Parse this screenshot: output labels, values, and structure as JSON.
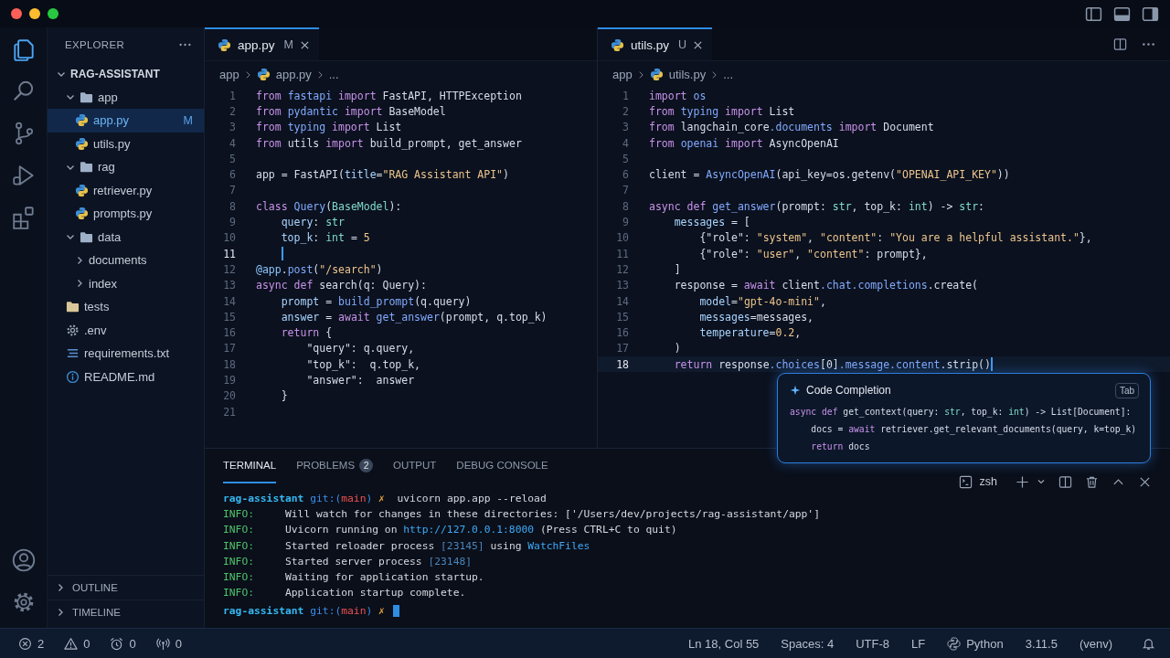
{
  "activity_bar": [
    {
      "kind": "explorer",
      "selected": true
    },
    {
      "kind": "search",
      "selected": false
    },
    {
      "kind": "source-control",
      "selected": false
    },
    {
      "kind": "run",
      "selected": false
    },
    {
      "kind": "extensions",
      "selected": false
    }
  ],
  "activity_bar_bottom": [
    {
      "kind": "account"
    },
    {
      "kind": "settings"
    }
  ],
  "sidebar": {
    "title": "EXPLORER",
    "tree": [
      {
        "label": "RAG-ASSISTANT",
        "kind": "root",
        "expanded": true,
        "children": [
          {
            "label": "app",
            "kind": "folder",
            "expanded": true,
            "children": [
              {
                "label": "app.py",
                "kind": "python",
                "badge": "M",
                "selected": true
              },
              {
                "label": "utils.py",
                "kind": "python",
                "selected": false
              }
            ]
          },
          {
            "label": "rag",
            "kind": "folder",
            "expanded": true,
            "children": [
              {
                "label": "retriever.py",
                "kind": "python",
                "selected": false
              },
              {
                "label": "prompts.py",
                "kind": "python",
                "selected": false
              }
            ]
          },
          {
            "label": "data",
            "kind": "folder",
            "expanded": true,
            "children": [
              {
                "label": "documents",
                "kind": "dir",
                "expanded": false
              },
              {
                "label": "index",
                "kind": "dir",
                "expanded": false
              }
            ]
          },
          {
            "label": "tests",
            "kind": "folder",
            "selected": false
          },
          {
            "label": ".env",
            "kind": "config",
            "selected": false
          },
          {
            "label": "requirements.txt",
            "kind": "text",
            "selected": false
          },
          {
            "label": "README.md",
            "kind": "info",
            "selected": false
          }
        ]
      }
    ],
    "sections": [
      {
        "label": "OUTLINE",
        "expanded": false
      },
      {
        "label": "TIMELINE",
        "expanded": false
      }
    ]
  },
  "editor_groups": [
    {
      "tabs": [
        {
          "label": "app.py",
          "status": "M",
          "selected": true
        }
      ],
      "breadcrumbs": [
        "app",
        "app.py",
        "..."
      ],
      "lines": [
        {
          "n": "1",
          "tokens": [
            {
              "kind": "kw",
              "text": "from"
            },
            {
              "kind": "mod",
              "text": " fastapi"
            },
            {
              "kind": "kw",
              "text": " import"
            },
            {
              "kind": "p",
              "text": " FastAPI, HTTPException"
            }
          ]
        },
        {
          "n": "2",
          "tokens": [
            {
              "kind": "kw",
              "text": "from"
            },
            {
              "kind": "mod",
              "text": " pydantic"
            },
            {
              "kind": "kw",
              "text": " import"
            },
            {
              "kind": "p",
              "text": " BaseModel"
            }
          ]
        },
        {
          "n": "3",
          "tokens": [
            {
              "kind": "kw",
              "text": "from"
            },
            {
              "kind": "mod",
              "text": " typing"
            },
            {
              "kind": "kw",
              "text": " import"
            },
            {
              "kind": "p",
              "text": " List"
            }
          ]
        },
        {
          "n": "4",
          "tokens": [
            {
              "kind": "kw",
              "text": "from"
            },
            {
              "kind": "p",
              "text": " utils "
            },
            {
              "kind": "kw",
              "text": "import"
            },
            {
              "kind": "p",
              "text": " build_prompt, get_answer"
            }
          ]
        },
        {
          "n": "5"
        },
        {
          "n": "6",
          "tokens": [
            {
              "kind": "p",
              "text": "app = FastAPI("
            },
            {
              "kind": "attr",
              "text": "title"
            },
            {
              "kind": "p",
              "text": "="
            },
            {
              "kind": "str",
              "text": "\"RAG Assistant API\""
            },
            {
              "kind": "p",
              "text": ")"
            }
          ]
        },
        {
          "n": "7"
        },
        {
          "n": "8",
          "tokens": [
            {
              "kind": "kw",
              "text": "class"
            },
            {
              "kind": "fn",
              "text": " Query"
            },
            {
              "kind": "p",
              "text": "("
            },
            {
              "kind": "type",
              "text": "BaseModel"
            },
            {
              "kind": "p",
              "text": "):"
            }
          ]
        },
        {
          "n": "9",
          "tokens": [
            {
              "kind": "attr",
              "text": "    query"
            },
            {
              "kind": "p",
              "text": ": "
            },
            {
              "kind": "type",
              "text": "str"
            }
          ]
        },
        {
          "n": "10",
          "tokens": [
            {
              "kind": "attr",
              "text": "    top_k"
            },
            {
              "kind": "p",
              "text": ": "
            },
            {
              "kind": "type",
              "text": "int"
            },
            {
              "kind": "p",
              "text": " = "
            },
            {
              "kind": "num",
              "text": "5"
            }
          ]
        },
        {
          "n": "11",
          "cursor": true
        },
        {
          "n": "12",
          "tokens": [
            {
              "kind": "deco",
              "text": "@app"
            },
            {
              "kind": "p",
              "text": "."
            },
            {
              "kind": "fn",
              "text": "post"
            },
            {
              "kind": "p",
              "text": "("
            },
            {
              "kind": "str",
              "text": "\"/search\""
            },
            {
              "kind": "p",
              "text": ")"
            }
          ]
        },
        {
          "n": "13",
          "tokens": [
            {
              "kind": "kw",
              "text": "async def"
            },
            {
              "kind": "p",
              "text": " search(q: Query):"
            }
          ]
        },
        {
          "n": "14",
          "tokens": [
            {
              "kind": "attr",
              "text": "    prompt"
            },
            {
              "kind": "p",
              "text": " = "
            },
            {
              "kind": "fn",
              "text": "build_prompt"
            },
            {
              "kind": "p",
              "text": "(q.query)"
            }
          ]
        },
        {
          "n": "15",
          "tokens": [
            {
              "kind": "attr",
              "text": "    answer"
            },
            {
              "kind": "p",
              "text": " = "
            },
            {
              "kind": "kw",
              "text": "await"
            },
            {
              "kind": "fn",
              "text": " get_answer"
            },
            {
              "kind": "p",
              "text": "(prompt, q.top_k)"
            }
          ]
        },
        {
          "n": "16",
          "tokens": [
            {
              "kind": "kw",
              "text": "    return"
            },
            {
              "kind": "p",
              "text": " {"
            }
          ]
        },
        {
          "n": "17",
          "tokens": [
            {
              "kind": "p",
              "text": "        \"query\": q.query,"
            }
          ]
        },
        {
          "n": "18",
          "tokens": [
            {
              "kind": "p",
              "text": "        \"top_k\":  q.top_k,"
            }
          ]
        },
        {
          "n": "19",
          "tokens": [
            {
              "kind": "p",
              "text": "        \"answer\":  answer"
            }
          ]
        },
        {
          "n": "20",
          "tokens": [
            {
              "kind": "p",
              "text": "    }"
            }
          ]
        },
        {
          "n": "21"
        }
      ]
    },
    {
      "tabs": [
        {
          "label": "utils.py",
          "status": "U",
          "selected": true
        }
      ],
      "breadcrumbs": [
        "app",
        "utils.py",
        "..."
      ],
      "lines": [
        {
          "n": "1",
          "tokens": [
            {
              "kind": "kw",
              "text": "import"
            },
            {
              "kind": "mod",
              "text": " os"
            }
          ]
        },
        {
          "n": "2",
          "tokens": [
            {
              "kind": "kw",
              "text": "from"
            },
            {
              "kind": "mod",
              "text": " typing"
            },
            {
              "kind": "kw",
              "text": " import"
            },
            {
              "kind": "p",
              "text": " List"
            }
          ]
        },
        {
          "n": "3",
          "tokens": [
            {
              "kind": "kw",
              "text": "from"
            },
            {
              "kind": "p",
              "text": " langchain_core"
            },
            {
              "kind": "mod",
              "text": ".documents"
            },
            {
              "kind": "kw",
              "text": " import"
            },
            {
              "kind": "p",
              "text": " Document"
            }
          ]
        },
        {
          "n": "4",
          "tokens": [
            {
              "kind": "kw",
              "text": "from"
            },
            {
              "kind": "mod",
              "text": " openai"
            },
            {
              "kind": "kw",
              "text": " import"
            },
            {
              "kind": "p",
              "text": " AsyncOpenAI"
            }
          ]
        },
        {
          "n": "5"
        },
        {
          "n": "6",
          "tokens": [
            {
              "kind": "p",
              "text": "client = "
            },
            {
              "kind": "fn",
              "text": "AsyncOpenAI"
            },
            {
              "kind": "p",
              "text": "(api_key=os.getenv("
            },
            {
              "kind": "str",
              "text": "\"OPENAI_API_KEY\""
            },
            {
              "kind": "p",
              "text": "))"
            }
          ]
        },
        {
          "n": "7"
        },
        {
          "n": "8",
          "tokens": [
            {
              "kind": "kw",
              "text": "async def"
            },
            {
              "kind": "fn",
              "text": " get_answer"
            },
            {
              "kind": "p",
              "text": "(prompt: "
            },
            {
              "kind": "type",
              "text": "str"
            },
            {
              "kind": "p",
              "text": ", top_k: "
            },
            {
              "kind": "type",
              "text": "int"
            },
            {
              "kind": "p",
              "text": ") -> "
            },
            {
              "kind": "type",
              "text": "str"
            },
            {
              "kind": "p",
              "text": ":"
            }
          ]
        },
        {
          "n": "9",
          "tokens": [
            {
              "kind": "attr",
              "text": "    messages"
            },
            {
              "kind": "p",
              "text": " = ["
            }
          ]
        },
        {
          "n": "10",
          "tokens": [
            {
              "kind": "p",
              "text": "        {\"role\": "
            },
            {
              "kind": "str",
              "text": "\"system\""
            },
            {
              "kind": "p",
              "text": ", "
            },
            {
              "kind": "str",
              "text": "\"content\""
            },
            {
              "kind": "p",
              "text": ": "
            },
            {
              "kind": "str",
              "text": "\"You are a helpful assistant.\""
            },
            {
              "kind": "p",
              "text": "},"
            }
          ]
        },
        {
          "n": "11",
          "tokens": [
            {
              "kind": "p",
              "text": "        {\"role\": "
            },
            {
              "kind": "str",
              "text": "\"user\""
            },
            {
              "kind": "p",
              "text": ", "
            },
            {
              "kind": "str",
              "text": "\"content\""
            },
            {
              "kind": "p",
              "text": ": prompt},"
            }
          ]
        },
        {
          "n": "12",
          "tokens": [
            {
              "kind": "p",
              "text": "    ]"
            }
          ]
        },
        {
          "n": "13",
          "tokens": [
            {
              "kind": "p",
              "text": "    response = "
            },
            {
              "kind": "kw",
              "text": "await"
            },
            {
              "kind": "p",
              "text": " client"
            },
            {
              "kind": "mod",
              "text": ".chat.completions"
            },
            {
              "kind": "p",
              "text": ".create("
            }
          ]
        },
        {
          "n": "14",
          "tokens": [
            {
              "kind": "attr",
              "text": "        model"
            },
            {
              "kind": "p",
              "text": "="
            },
            {
              "kind": "str",
              "text": "\"gpt-4o-mini\""
            },
            {
              "kind": "p",
              "text": ","
            }
          ]
        },
        {
          "n": "15",
          "tokens": [
            {
              "kind": "attr",
              "text": "        messages"
            },
            {
              "kind": "p",
              "text": "=messages,"
            }
          ]
        },
        {
          "n": "16",
          "tokens": [
            {
              "kind": "attr",
              "text": "        temperature"
            },
            {
              "kind": "p",
              "text": "="
            },
            {
              "kind": "num",
              "text": "0.2"
            },
            {
              "kind": "p",
              "text": ","
            }
          ]
        },
        {
          "n": "17",
          "tokens": [
            {
              "kind": "p",
              "text": "    )"
            }
          ]
        },
        {
          "n": "18",
          "tokens": [
            {
              "kind": "kw",
              "text": "    return"
            },
            {
              "kind": "p",
              "text": " response"
            },
            {
              "kind": "mod",
              "text": ".choices"
            },
            {
              "kind": "p",
              "text": "[0]"
            },
            {
              "kind": "mod",
              "text": ".message.content"
            },
            {
              "kind": "p",
              "text": ".strip()"
            }
          ],
          "cursor": true
        }
      ]
    }
  ],
  "completion": {
    "title": "Code Completion",
    "key": "Tab",
    "lines": [
      {
        "tokens": [
          {
            "kind": "kw",
            "text": "async def"
          },
          {
            "kind": "p",
            "text": " get_context(query: "
          },
          {
            "kind": "type",
            "text": "str"
          },
          {
            "kind": "p",
            "text": ", top_k: "
          },
          {
            "kind": "type",
            "text": "int"
          },
          {
            "kind": "p",
            "text": ") -> List[Document]:"
          }
        ]
      },
      {
        "tokens": [
          {
            "kind": "p",
            "text": "    docs = "
          },
          {
            "kind": "kw",
            "text": "await"
          },
          {
            "kind": "p",
            "text": " retriever.get_relevant_documents(query, k=top_k)"
          }
        ]
      },
      {
        "tokens": [
          {
            "kind": "kw",
            "text": "    return"
          },
          {
            "kind": "p",
            "text": " docs"
          }
        ]
      }
    ]
  },
  "panel": {
    "tabs": [
      {
        "label": "TERMINAL",
        "selected": true
      },
      {
        "label": "PROBLEMS",
        "badge": "2",
        "selected": false
      },
      {
        "label": "OUTPUT",
        "selected": false
      },
      {
        "label": "DEBUG CONSOLE",
        "selected": false
      }
    ],
    "shell": "zsh",
    "lines": [
      {
        "tokens": [
          {
            "kind": "dir",
            "text": "rag-assistant"
          },
          {
            "kind": "git",
            "text": " git:("
          },
          {
            "kind": "branch",
            "text": "main"
          },
          {
            "kind": "git",
            "text": ")"
          },
          {
            "kind": "x",
            "text": " ✗"
          },
          {
            "kind": "cmd",
            "text": "  uvicorn app.app --reload"
          }
        ]
      },
      {
        "tokens": [
          {
            "kind": "info",
            "text": "INFO:"
          },
          {
            "kind": "cmd",
            "text": "     Will watch for changes in these directories: ['/Users/dev/projects/rag-assistant/app']"
          }
        ]
      },
      {
        "tokens": [
          {
            "kind": "info",
            "text": "INFO:"
          },
          {
            "kind": "cmd",
            "text": "     Uvicorn running on "
          },
          {
            "kind": "link",
            "text": "http://127.0.0.1:8000"
          },
          {
            "kind": "cmd",
            "text": " (Press CTRL+C to quit)"
          }
        ]
      },
      {
        "tokens": [
          {
            "kind": "info",
            "text": "INFO:"
          },
          {
            "kind": "cmd",
            "text": "     Started reloader process "
          },
          {
            "kind": "dim",
            "text": "[23145]"
          },
          {
            "kind": "cmd",
            "text": " using "
          },
          {
            "kind": "link",
            "text": "WatchFiles"
          }
        ]
      },
      {
        "tokens": [
          {
            "kind": "info",
            "text": "INFO:"
          },
          {
            "kind": "cmd",
            "text": "     Started server process "
          },
          {
            "kind": "dim",
            "text": "[23148]"
          }
        ]
      },
      {
        "tokens": [
          {
            "kind": "info",
            "text": "INFO:"
          },
          {
            "kind": "cmd",
            "text": "     Waiting for application startup."
          }
        ]
      },
      {
        "tokens": [
          {
            "kind": "info",
            "text": "INFO:"
          },
          {
            "kind": "cmd",
            "text": "     Application startup complete."
          }
        ]
      },
      {
        "tokens": [
          {
            "kind": "dir",
            "text": "rag-assistant"
          },
          {
            "kind": "git",
            "text": " git:("
          },
          {
            "kind": "branch",
            "text": "main"
          },
          {
            "kind": "git",
            "text": ")"
          },
          {
            "kind": "x",
            "text": " ✗"
          }
        ],
        "cursor": true
      }
    ]
  },
  "status_bar": {
    "left": [
      {
        "kind": "errors",
        "text": "2"
      },
      {
        "kind": "warnings",
        "text": "0"
      },
      {
        "kind": "alarm",
        "text": "0"
      },
      {
        "kind": "ports",
        "text": "0"
      }
    ],
    "right": [
      {
        "kind": "plain",
        "text": "Ln 18, Col 55"
      },
      {
        "kind": "plain",
        "text": "Spaces: 4"
      },
      {
        "kind": "plain",
        "text": "UTF-8"
      },
      {
        "kind": "plain",
        "text": "LF"
      },
      {
        "kind": "language",
        "text": "Python"
      },
      {
        "kind": "plain",
        "text": "3.11.5"
      },
      {
        "kind": "plain",
        "text": "(venv)"
      },
      {
        "kind": "bell"
      }
    ]
  }
}
